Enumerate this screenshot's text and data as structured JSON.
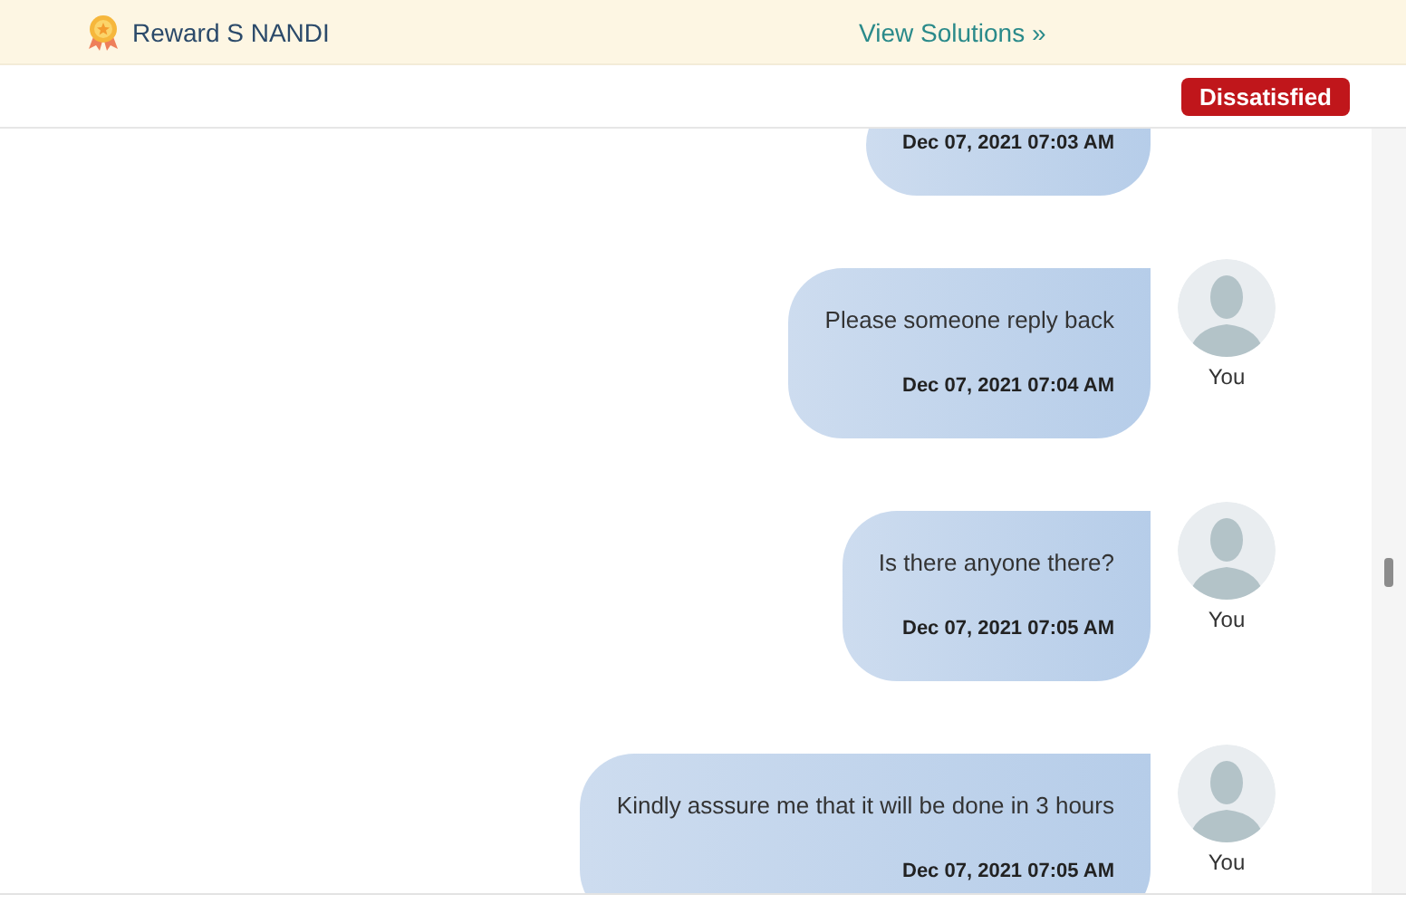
{
  "header": {
    "reward_name": "Reward S NANDI",
    "link": "View Solutions »"
  },
  "status_badge": "Dissatisfied",
  "messages": [
    {
      "time": "Dec 07, 2021 07:03 AM"
    },
    {
      "text": "Please someone reply back",
      "time": "Dec 07, 2021 07:04 AM",
      "author": "You"
    },
    {
      "text": "Is there anyone there?",
      "time": "Dec 07, 2021 07:05 AM",
      "author": "You"
    },
    {
      "text": "Kindly asssure me that it will be done in 3 hours",
      "time": "Dec 07, 2021 07:05 AM",
      "author": "You"
    }
  ]
}
